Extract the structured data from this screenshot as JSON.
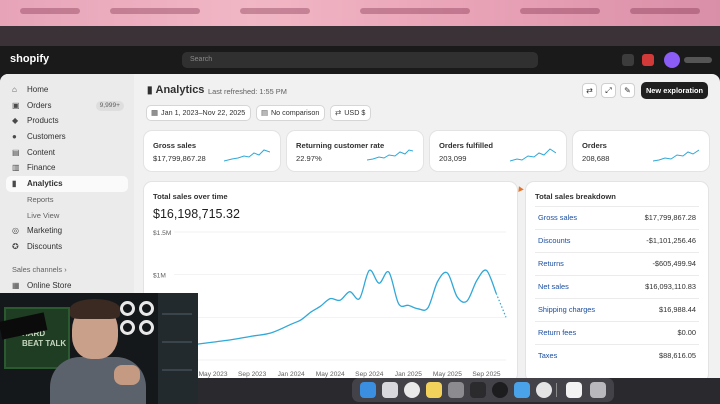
{
  "shopify_bar": {
    "logo_text": "shopify",
    "search_placeholder": "Search"
  },
  "sidebar": {
    "items": [
      {
        "label": "Home",
        "icon": "home-icon"
      },
      {
        "label": "Orders",
        "icon": "inbox-icon",
        "badge": "9,999+"
      },
      {
        "label": "Products",
        "icon": "tag-icon"
      },
      {
        "label": "Customers",
        "icon": "person-icon"
      },
      {
        "label": "Content",
        "icon": "file-icon"
      },
      {
        "label": "Finance",
        "icon": "bank-icon"
      },
      {
        "label": "Analytics",
        "icon": "bar-chart-icon",
        "active": true
      },
      {
        "label": "Reports",
        "sub": true
      },
      {
        "label": "Live View",
        "sub": true
      },
      {
        "label": "Marketing",
        "icon": "target-icon"
      },
      {
        "label": "Discounts",
        "icon": "discount-icon"
      }
    ],
    "sales_channels_label": "Sales channels",
    "channels": [
      {
        "label": "Online Store",
        "icon": "store-icon"
      }
    ]
  },
  "header": {
    "title": "Analytics",
    "last_refreshed": "Last refreshed: 1:55 PM",
    "new_exploration_label": "New exploration",
    "tools": [
      "refresh-icon",
      "expand-icon",
      "edit-icon"
    ]
  },
  "filters": {
    "date_range": "Jan 1, 2023–Nov 22, 2025",
    "comparison": "No comparison",
    "currency": "USD $"
  },
  "kpis": [
    {
      "label": "Gross sales",
      "value": "$17,799,867.28"
    },
    {
      "label": "Returning customer rate",
      "value": "22.97%"
    },
    {
      "label": "Orders fulfilled",
      "value": "203,099"
    },
    {
      "label": "Orders",
      "value": "208,688"
    }
  ],
  "sales_card": {
    "title": "Total sales over time",
    "total": "$16,198,715.32"
  },
  "chart_data": {
    "type": "line",
    "title": "Total sales over time",
    "xlabel": "",
    "ylabel": "",
    "y_tick_labels": [
      "$1.5M",
      "$1M"
    ],
    "ylim": [
      0,
      1500000
    ],
    "x_tick_labels": [
      "May 2023",
      "Sep 2023",
      "Jan 2024",
      "May 2024",
      "Sep 2024",
      "Jan 2025",
      "May 2025",
      "Sep 2025"
    ],
    "x": [
      "2023-01",
      "2023-03",
      "2023-05",
      "2023-07",
      "2023-09",
      "2023-11",
      "2024-01",
      "2024-02",
      "2024-03",
      "2024-04",
      "2024-05",
      "2024-06",
      "2024-07",
      "2024-08",
      "2024-09",
      "2024-10",
      "2024-11",
      "2024-12",
      "2025-01",
      "2025-02",
      "2025-03",
      "2025-04",
      "2025-05",
      "2025-06",
      "2025-07",
      "2025-08",
      "2025-09",
      "2025-10",
      "2025-11"
    ],
    "series": [
      {
        "values": [
          150000,
          180000,
          210000,
          240000,
          280000,
          320000,
          420000,
          470000,
          560000,
          630000,
          720000,
          700000,
          800000,
          720000,
          1050000,
          900000,
          1030000,
          660000,
          640000,
          600000,
          610000,
          920000,
          1020000,
          740000,
          690000,
          930000,
          1050000,
          780000,
          500000
        ],
        "projected_from_index": 27
      }
    ],
    "grid": true
  },
  "breakdown": {
    "title": "Total sales breakdown",
    "rows": [
      {
        "label": "Gross sales",
        "value": "$17,799,867.28"
      },
      {
        "label": "Discounts",
        "value": "-$1,101,256.46"
      },
      {
        "label": "Returns",
        "value": "-$605,499.94"
      },
      {
        "label": "Net sales",
        "value": "$16,093,110.83"
      },
      {
        "label": "Shipping charges",
        "value": "$16,988.44"
      },
      {
        "label": "Return fees",
        "value": "$0.00"
      },
      {
        "label": "Taxes",
        "value": "$88,616.05"
      }
    ]
  },
  "webcam": {
    "sign_text": "HARD BEAT TALK"
  },
  "dock": {
    "apps": [
      "finder-icon",
      "launchpad-icon",
      "chrome-icon",
      "notes-icon",
      "preview-icon",
      "terminal-icon",
      "activity-icon",
      "system-icon",
      "chrome-icon",
      "documents-icon",
      "trash-icon"
    ]
  },
  "colors": {
    "accent_line": "#30a8d8",
    "link_blue": "#1b4ea0",
    "primary_button": "#1f1f1f",
    "app_bg": "#f1f1f1"
  }
}
